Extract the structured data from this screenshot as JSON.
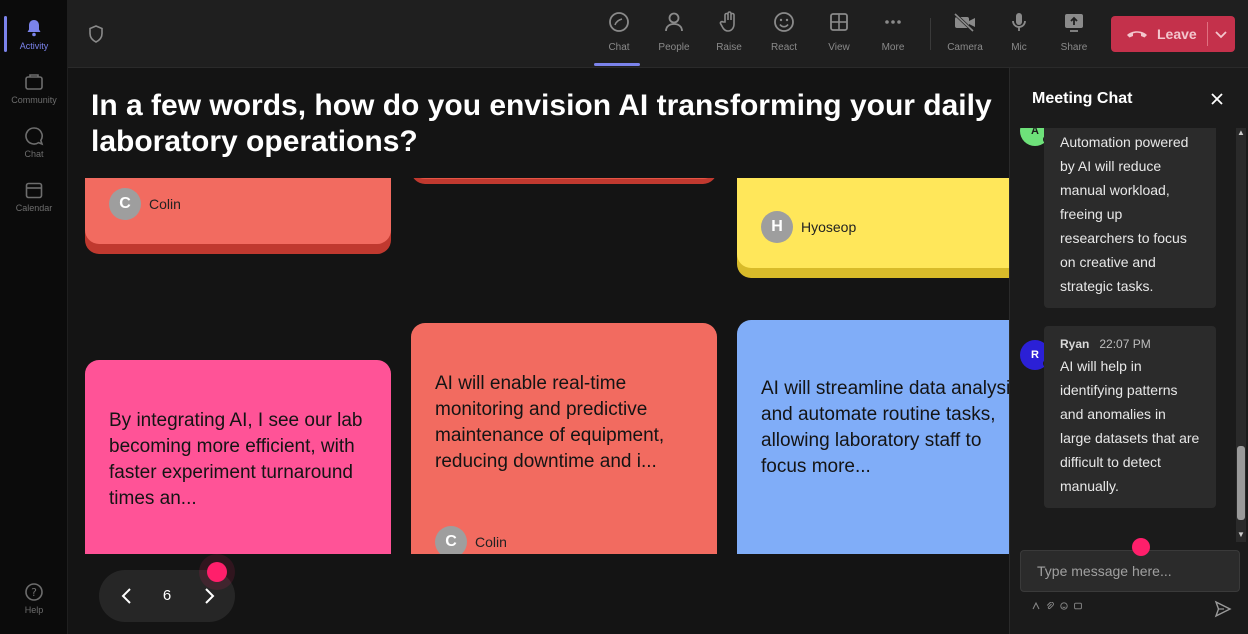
{
  "rail": {
    "items": [
      {
        "label": "Activity",
        "icon": "bell-icon",
        "active": true
      },
      {
        "label": "Community",
        "icon": "community-icon"
      },
      {
        "label": "Chat",
        "icon": "chat-icon"
      },
      {
        "label": "Calendar",
        "icon": "calendar-icon"
      },
      {
        "label": "Help",
        "icon": "help-icon"
      }
    ]
  },
  "toolbar": {
    "buttons": [
      {
        "label": "Chat",
        "icon": "chat-icon",
        "active": true
      },
      {
        "label": "People",
        "icon": "people-icon"
      },
      {
        "label": "Raise",
        "icon": "raise-hand-icon"
      },
      {
        "label": "React",
        "icon": "react-icon"
      },
      {
        "label": "View",
        "icon": "view-grid-icon"
      },
      {
        "label": "More",
        "icon": "more-icon"
      },
      {
        "label": "Camera",
        "icon": "camera-off-icon"
      },
      {
        "label": "Mic",
        "icon": "mic-icon"
      },
      {
        "label": "Share",
        "icon": "share-icon"
      }
    ],
    "leave_label": "Leave"
  },
  "question": "In a few words, how do you envision AI transforming your daily laboratory operations?",
  "cards": [
    {
      "author": "Colin",
      "initial": "C",
      "text": "",
      "color": "#f26b60"
    },
    {
      "author": "",
      "initial": "",
      "text": "",
      "color": "#e55445"
    },
    {
      "author": "Hyoseop",
      "initial": "H",
      "text": "",
      "color": "#ffe75a"
    },
    {
      "author": "",
      "initial": "",
      "text": "By integrating AI, I see our lab becoming more efficient, with faster experiment turnaround times an...",
      "color": "#ff5397"
    },
    {
      "author": "Colin",
      "initial": "C",
      "text": "AI will enable real-time monitoring and predictive maintenance of equipment, reducing downtime and i...",
      "color": "#f26b60"
    },
    {
      "author": "",
      "initial": "",
      "text": "AI will streamline data analysis and automate routine tasks, allowing laboratory staff to focus more...",
      "color": "#80adf8"
    }
  ],
  "pager": {
    "page": "6"
  },
  "chat": {
    "title": "Meeting Chat",
    "messages": [
      {
        "initial": "A",
        "sender": "",
        "time": "",
        "avatar_color": "#6ee17a",
        "text": "Automation powered by AI will reduce manual workload, freeing up researchers to focus on creative and strategic tasks."
      },
      {
        "initial": "R",
        "sender": "Ryan",
        "time": "22:07 PM",
        "avatar_color": "#2b20d6",
        "text": "AI will help in identifying patterns and anomalies in large datasets that are difficult to detect manually."
      }
    ],
    "compose_placeholder": "Type message here..."
  }
}
